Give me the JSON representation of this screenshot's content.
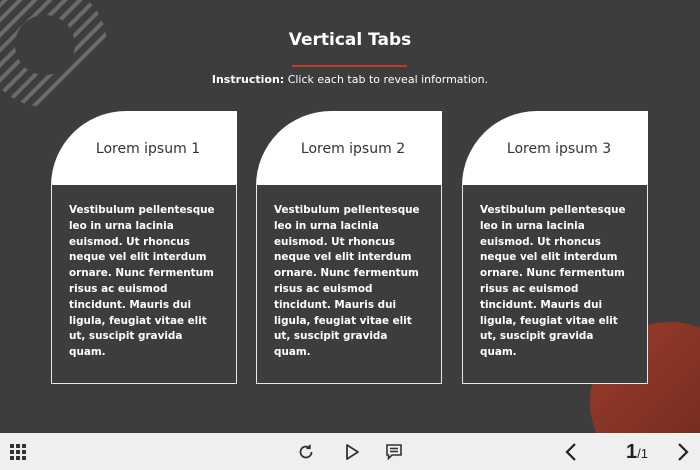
{
  "header": {
    "title": "Vertical Tabs",
    "instruction_bold": "Instruction:",
    "instruction_text": " Click each tab to reveal information."
  },
  "colors": {
    "background": "#3d3d3d",
    "accent": "#c0392b",
    "card": "#ffffff",
    "bottombar": "#efefef"
  },
  "tabs": [
    {
      "label": "Lorem ipsum 1",
      "body": "Vestibulum pellentesque leo in urna lacinia euismod. Ut rhoncus neque vel elit interdum ornare. Nunc fermentum risus ac euismod tincidunt. Mauris dui ligula, feugiat vitae elit ut, suscipit gravida quam."
    },
    {
      "label": "Lorem ipsum 2",
      "body": "Vestibulum pellentesque leo in urna lacinia euismod. Ut rhoncus neque vel elit interdum ornare. Nunc fermentum risus ac euismod tincidunt. Mauris dui ligula, feugiat vitae elit ut, suscipit gravida quam."
    },
    {
      "label": "Lorem ipsum 3",
      "body": "Vestibulum pellentesque leo in urna lacinia euismod. Ut rhoncus neque vel elit interdum ornare. Nunc fermentum risus ac euismod tincidunt. Mauris dui ligula, feugiat vitae elit ut, suscipit gravida quam."
    }
  ],
  "footer": {
    "icons": [
      "grid-menu-icon",
      "replay-icon",
      "play-icon",
      "comment-icon",
      "prev-arrow-icon",
      "next-arrow-icon"
    ],
    "page_current": "1",
    "page_total": "/1"
  }
}
